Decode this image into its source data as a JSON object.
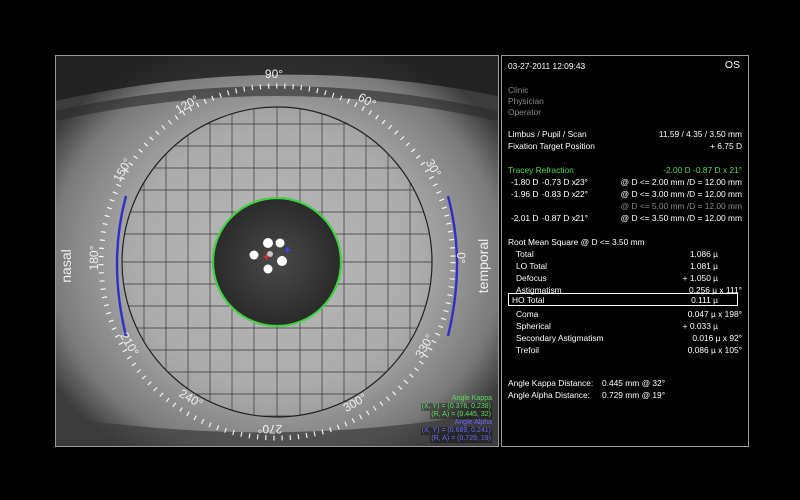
{
  "eye_view": {
    "side_labels": {
      "left": "nasal",
      "right": "temporal"
    },
    "angle_labels": [
      "90°",
      "60°",
      "30°",
      "0°",
      "330°",
      "300°",
      "270°",
      "240°",
      "210°",
      "180°",
      "150°",
      "120°"
    ],
    "legend": {
      "kappa_title": "Angle Kappa",
      "kappa_xy": "(X, Y) = (0.376, 0.238)",
      "kappa_ra": "(R, A) = (0.445, 32)",
      "alpha_title": "Angle Alpha",
      "alpha_xy": "(X, Y) = (0.689, 0.241)",
      "alpha_ra": "(R, A) = (0.729, 19)"
    },
    "colors": {
      "pupil_outline": "#3fd13f",
      "limbus_arc": "#2f2fc8",
      "kappa_marker": "#e03030",
      "alpha_marker": "#4040ff"
    }
  },
  "info": {
    "datetime": "03-27-2011  12:09:43",
    "eye": "OS",
    "meta": [
      "Clinic",
      "Physician",
      "Operator"
    ],
    "limbus_label": "Limbus / Pupil / Scan",
    "limbus_value": "11.59 / 4.35 / 3.50 mm",
    "fixation_label": "Fixation Target Position",
    "fixation_value": "+ 6.75 D",
    "refraction_title": "Tracey Refraction",
    "refraction_main": "-2.00 D  -0.87 D x 21°",
    "refraction_rows": [
      {
        "a": "-1.80 D",
        "b": "-0.73 D x",
        "c": "23°",
        "d": "@ D <= 2.00 mm /D = 12.00 mm",
        "dim": false
      },
      {
        "a": "-1.96 D",
        "b": "-0.83 D x",
        "c": "22°",
        "d": "@ D <= 3.00 mm /D = 12.00 mm",
        "dim": false
      },
      {
        "a": "",
        "b": "",
        "c": "",
        "d": "@ D <= 5.00 mm /D = 12.00 mm",
        "dim": true
      },
      {
        "a": "-2.01 D",
        "b": "-0.87 D x",
        "c": "21°",
        "d": "@ D <= 3.50 mm /D = 12.00 mm",
        "dim": false
      }
    ],
    "rms_title": "Root Mean Square @ D <= 3.50 mm",
    "rms_rows": [
      {
        "label": "Total",
        "value": "1.086 µ"
      },
      {
        "label": "LO Total",
        "value": "1.081 µ"
      },
      {
        "label": "Defocus",
        "value": "+ 1.050 µ"
      },
      {
        "label": "Astigmatism",
        "value": "0.256 µ x 111°"
      },
      {
        "label": "HO Total",
        "value": "0.111 µ"
      },
      {
        "label": "Coma",
        "value": "0.047 µ x 198°"
      },
      {
        "label": "Spherical",
        "value": "+ 0.033 µ"
      },
      {
        "label": "Secondary Astigmatism",
        "value": "0.016 µ x  92°"
      },
      {
        "label": "Trefoil",
        "value": "0.086 µ x 105°"
      }
    ],
    "kappa_label": "Angle Kappa Distance:",
    "kappa_value": "0.445 mm @ 32°",
    "alpha_label": "Angle Alpha Distance:",
    "alpha_value": "0.729 mm @ 19°"
  }
}
